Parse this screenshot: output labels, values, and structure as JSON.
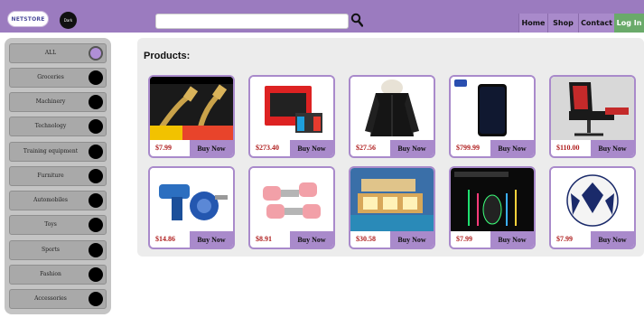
{
  "header": {
    "logo_text": "NETSTORE",
    "dark_toggle_label": "Dark",
    "search": {
      "value": "",
      "placeholder": ""
    },
    "nav": {
      "home": "Home",
      "shop": "Shop",
      "contact": "Contact",
      "login": "Log In"
    }
  },
  "sidebar": {
    "categories": [
      {
        "label": "ALL",
        "active": true
      },
      {
        "label": "Groceries",
        "active": false
      },
      {
        "label": "Machinery",
        "active": false
      },
      {
        "label": "Technology",
        "active": false
      },
      {
        "label": "Training equipment",
        "active": false
      },
      {
        "label": "Furniture",
        "active": false
      },
      {
        "label": "Automobiles",
        "active": false
      },
      {
        "label": "Toys",
        "active": false
      },
      {
        "label": "Sports",
        "active": false
      },
      {
        "label": "Fashion",
        "active": false
      },
      {
        "label": "Accessories",
        "active": false
      }
    ]
  },
  "main": {
    "title": "Products:",
    "products": [
      {
        "price": "$7.99",
        "button": "Buy Now",
        "image": "hdmi-cable"
      },
      {
        "price": "$273.40",
        "button": "Buy Now",
        "image": "game-console"
      },
      {
        "price": "$27.56",
        "button": "Buy Now",
        "image": "winter-jacket"
      },
      {
        "price": "$799.99",
        "button": "Buy Now",
        "image": "smartphone"
      },
      {
        "price": "$110.00",
        "button": "Buy Now",
        "image": "gaming-chair"
      },
      {
        "price": "$14.86",
        "button": "Buy Now",
        "image": "drill-pump"
      },
      {
        "price": "$8.91",
        "button": "Buy Now",
        "image": "dumbbells"
      },
      {
        "price": "$30.58",
        "button": "Buy Now",
        "image": "house"
      },
      {
        "price": "$7.99",
        "button": "Buy Now",
        "image": "gaming-mouse"
      },
      {
        "price": "$7.99",
        "button": "Buy Now",
        "image": "soccer-ball"
      }
    ]
  },
  "colors": {
    "accent": "#a98acb",
    "header": "#9b7bbf",
    "login": "#6aaa6a",
    "price": "#b02020"
  }
}
